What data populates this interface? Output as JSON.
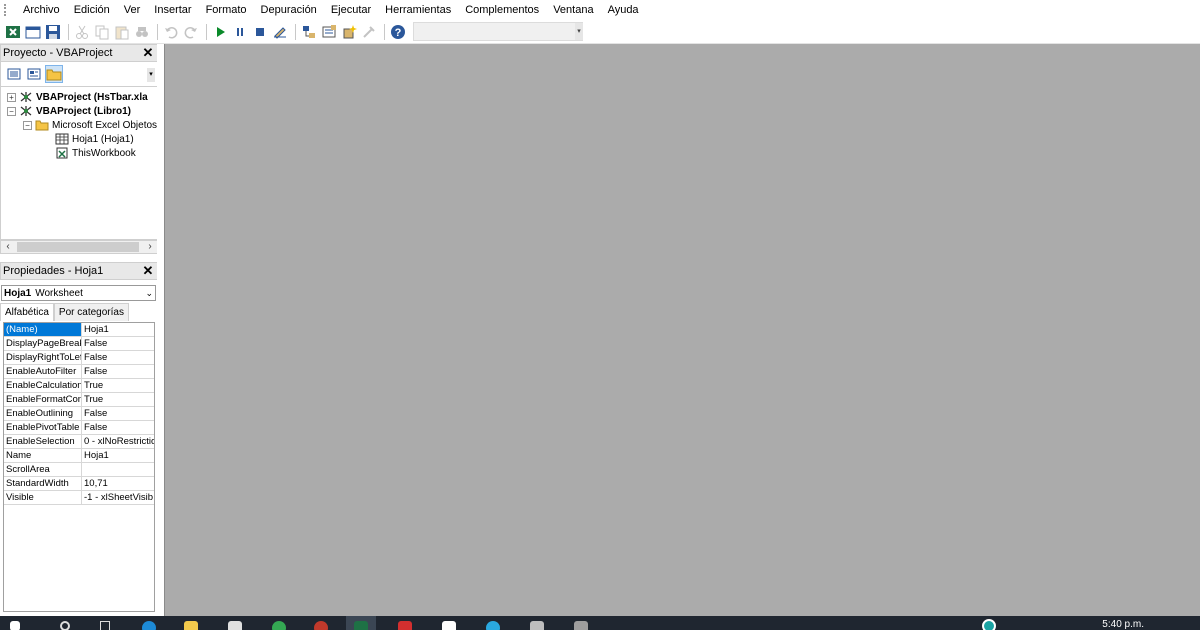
{
  "menubar": {
    "items": [
      "Archivo",
      "Edición",
      "Ver",
      "Insertar",
      "Formato",
      "Depuración",
      "Ejecutar",
      "Herramientas",
      "Complementos",
      "Ventana",
      "Ayuda"
    ]
  },
  "project_pane": {
    "title": "Proyecto - VBAProject",
    "tree": {
      "project1": "VBAProject (HsTbar.xla",
      "project2": "VBAProject (Libro1)",
      "folder": "Microsoft Excel Objetos",
      "sheet": "Hoja1 (Hoja1)",
      "workbook": "ThisWorkbook"
    }
  },
  "properties_pane": {
    "title": "Propiedades - Hoja1",
    "object_name": "Hoja1",
    "object_type": "Worksheet",
    "tabs": [
      "Alfabética",
      "Por categorías"
    ],
    "rows": [
      {
        "name": "(Name)",
        "value": "Hoja1"
      },
      {
        "name": "DisplayPageBreak",
        "value": "False"
      },
      {
        "name": "DisplayRightToLef",
        "value": "False"
      },
      {
        "name": "EnableAutoFilter",
        "value": "False"
      },
      {
        "name": "EnableCalculation",
        "value": "True"
      },
      {
        "name": "EnableFormatCon",
        "value": "True"
      },
      {
        "name": "EnableOutlining",
        "value": "False"
      },
      {
        "name": "EnablePivotTable",
        "value": "False"
      },
      {
        "name": "EnableSelection",
        "value": "0 - xlNoRestrictio"
      },
      {
        "name": "Name",
        "value": "Hoja1"
      },
      {
        "name": "ScrollArea",
        "value": ""
      },
      {
        "name": "StandardWidth",
        "value": "10,71"
      },
      {
        "name": "Visible",
        "value": "-1 - xlSheetVisib"
      }
    ]
  },
  "taskbar": {
    "clock": "5:40 p.m."
  },
  "colors": {
    "main_bg": "#ababab",
    "selection": "#0078d7",
    "taskbar": "#1f2630"
  }
}
